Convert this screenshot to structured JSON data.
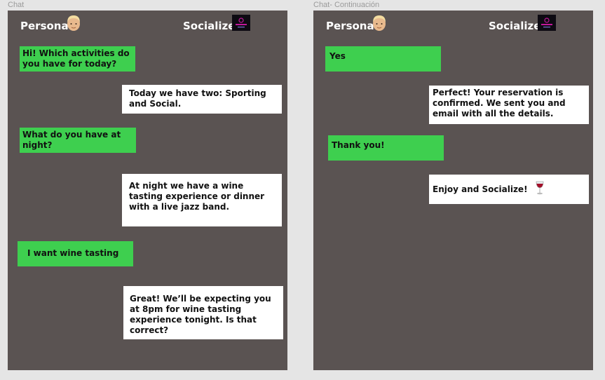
{
  "frames": [
    {
      "label": "Chat",
      "header": {
        "user_name": "Persona",
        "brand_name": "Socialize"
      },
      "messages": [
        {
          "from": "user",
          "text": "Hi! Which activities do you have for today?"
        },
        {
          "from": "bot",
          "text": "Today we have two: Sporting and Social."
        },
        {
          "from": "user",
          "text": "What do you have at night?"
        },
        {
          "from": "bot",
          "text": "At night we have a wine tasting experience or dinner with a live jazz band."
        },
        {
          "from": "user",
          "text": "I want wine tasting"
        },
        {
          "from": "bot",
          "text": "Great! We’ll be expecting you at 8pm for wine tasting experience tonight. Is that correct?"
        }
      ]
    },
    {
      "label": "Chat- Continuación",
      "header": {
        "user_name": "Persona",
        "brand_name": "Socialize"
      },
      "messages": [
        {
          "from": "user",
          "text": "Yes"
        },
        {
          "from": "bot",
          "text": "Perfect! Your reservation is confirmed. We sent you and email with all the details."
        },
        {
          "from": "user",
          "text": "Thank you!"
        },
        {
          "from": "bot",
          "text": "Enjoy and Socialize!",
          "icon": "wine-glass-icon"
        }
      ]
    }
  ],
  "colors": {
    "canvas": "#e5e5e5",
    "frame": "#5a5352",
    "user_bubble": "#3ecf4f",
    "bot_bubble": "#ffffff",
    "logo_accent": "#c2189b"
  }
}
